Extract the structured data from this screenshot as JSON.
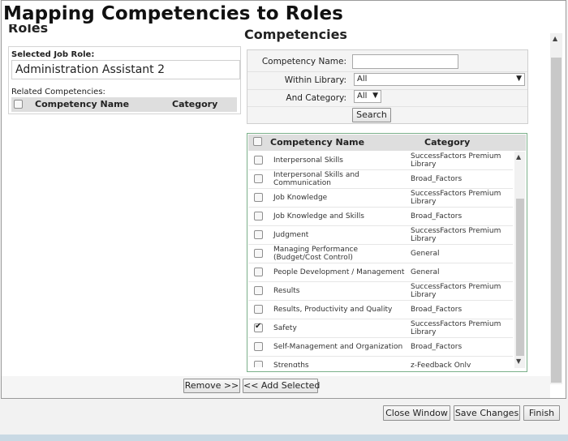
{
  "page_title": "Mapping Competencies to Roles",
  "roles_panel": {
    "heading": "Roles",
    "selected_role_label": "Selected Job Role:",
    "selected_role_value": "Administration Assistant 2",
    "related_label": "Related Competencies:",
    "col_name": "Competency Name",
    "col_category": "Category"
  },
  "competencies_panel": {
    "heading": "Competencies",
    "search": {
      "name_label": "Competency Name:",
      "name_value": "",
      "library_label": "Within Library:",
      "library_value": "All",
      "category_label": "And Category:",
      "category_value": "All",
      "search_button": "Search"
    },
    "col_name": "Competency Name",
    "col_category": "Category",
    "rows": [
      {
        "name": "Interpersonal Skills",
        "category": "SuccessFactors Premium Library",
        "checked": false
      },
      {
        "name": "Interpersonal Skills and Communication",
        "category": "Broad_Factors",
        "checked": false
      },
      {
        "name": "Job Knowledge",
        "category": "SuccessFactors Premium Library",
        "checked": false
      },
      {
        "name": "Job Knowledge and Skills",
        "category": "Broad_Factors",
        "checked": false
      },
      {
        "name": "Judgment",
        "category": "SuccessFactors Premium Library",
        "checked": false
      },
      {
        "name": "Managing Performance (Budget/Cost Control)",
        "category": "General",
        "checked": false
      },
      {
        "name": "People Development / Management",
        "category": "General",
        "checked": false
      },
      {
        "name": "Results",
        "category": "SuccessFactors Premium Library",
        "checked": false
      },
      {
        "name": "Results, Productivity and Quality",
        "category": "Broad_Factors",
        "checked": false
      },
      {
        "name": "Safety",
        "category": "SuccessFactors Premium Library",
        "checked": true
      },
      {
        "name": "Self-Management and Organization",
        "category": "Broad_Factors",
        "checked": false
      },
      {
        "name": "Strengths",
        "category": "z-Feedback Only",
        "checked": false
      }
    ]
  },
  "actions": {
    "remove": "Remove >>",
    "add_selected": "<< Add Selected"
  },
  "footer": {
    "close": "Close Window",
    "save": "Save Changes",
    "finish": "Finish"
  },
  "icons": {
    "dropdown": "▼",
    "scroll_up": "▲",
    "scroll_down": "▼"
  }
}
